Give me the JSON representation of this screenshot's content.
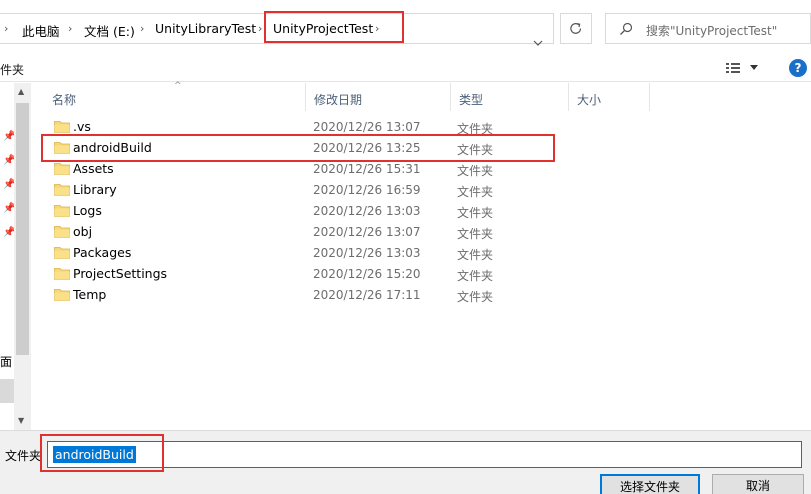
{
  "breadcrumb": {
    "items": [
      "此电脑",
      "文档 (E:)",
      "UnityLibraryTest",
      "UnityProjectTest"
    ]
  },
  "search": {
    "placeholder": "搜索\"UnityProjectTest\""
  },
  "toolbar": {
    "label": "件夹"
  },
  "nav": {
    "partial_item": "面"
  },
  "columns": {
    "name": "名称",
    "date": "修改日期",
    "type": "类型",
    "size": "大小"
  },
  "files": [
    {
      "name": ".vs",
      "date": "2020/12/26 13:07",
      "type": "文件夹"
    },
    {
      "name": "androidBuild",
      "date": "2020/12/26 13:25",
      "type": "文件夹"
    },
    {
      "name": "Assets",
      "date": "2020/12/26 15:31",
      "type": "文件夹"
    },
    {
      "name": "Library",
      "date": "2020/12/26 16:59",
      "type": "文件夹"
    },
    {
      "name": "Logs",
      "date": "2020/12/26 13:03",
      "type": "文件夹"
    },
    {
      "name": "obj",
      "date": "2020/12/26 13:07",
      "type": "文件夹"
    },
    {
      "name": "Packages",
      "date": "2020/12/26 13:03",
      "type": "文件夹"
    },
    {
      "name": "ProjectSettings",
      "date": "2020/12/26 15:20",
      "type": "文件夹"
    },
    {
      "name": "Temp",
      "date": "2020/12/26 17:11",
      "type": "文件夹"
    }
  ],
  "bottom": {
    "folder_label": "文件夹",
    "folder_value": "androidBuild",
    "select_button": "选择文件夹",
    "cancel_button": "取消"
  },
  "icons": {
    "folder": "folder-icon",
    "pin": "pin-icon",
    "refresh": "refresh-icon",
    "search": "search-icon",
    "view": "view-options-icon",
    "help": "help-icon"
  },
  "colors": {
    "selection": "#0078d7",
    "highlight": "#e03131",
    "folder": "#f8d775"
  }
}
